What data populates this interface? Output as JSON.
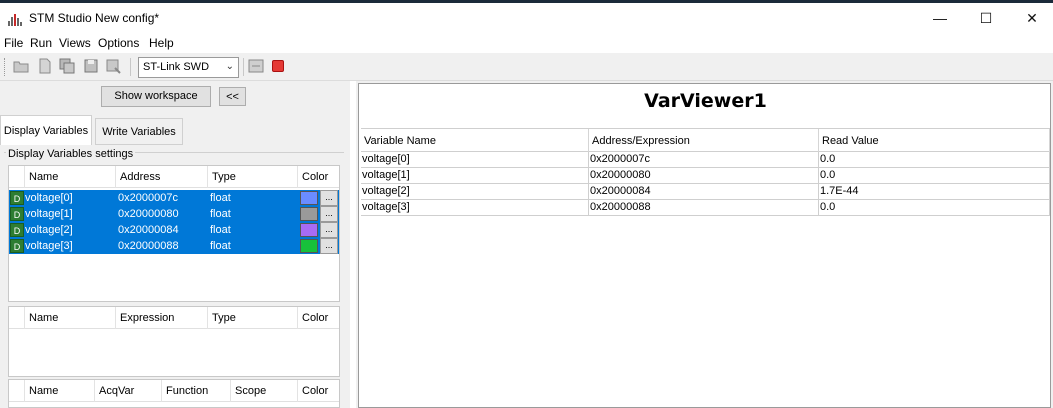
{
  "window": {
    "title": "STM Studio New config*",
    "minimize_glyph": "—",
    "maximize_glyph": "☐",
    "close_glyph": "✕"
  },
  "menu": [
    "File",
    "Run",
    "Views",
    "Options",
    "Help"
  ],
  "toolbar": {
    "probe": "ST-Link SWD",
    "icons": [
      "open-folder-icon",
      "new-file-icon",
      "save-all-icon",
      "save-icon",
      "export-icon",
      "connect-icon",
      "stop-icon"
    ]
  },
  "left": {
    "show_workspace": "Show workspace",
    "collapse": "<<",
    "tabs": [
      "Display Variables",
      "Write Variables"
    ],
    "group_label": "Display Variables settings",
    "var_headers": [
      "Name",
      "Address",
      "Type",
      "Color"
    ],
    "variables": [
      {
        "badge": "D",
        "name": "voltage[0]",
        "address": "0x2000007c",
        "type": "float",
        "color": "#6a8cff",
        "dots": "..."
      },
      {
        "badge": "D",
        "name": "voltage[1]",
        "address": "0x20000080",
        "type": "float",
        "color": "#9a9a9a",
        "dots": "..."
      },
      {
        "badge": "D",
        "name": "voltage[2]",
        "address": "0x20000084",
        "type": "float",
        "color": "#a86bf5",
        "dots": "..."
      },
      {
        "badge": "D",
        "name": "voltage[3]",
        "address": "0x20000088",
        "type": "float",
        "color": "#17c13b",
        "dots": "..."
      }
    ],
    "expr_headers": [
      "Name",
      "Expression",
      "Type",
      "Color"
    ],
    "acq_headers": [
      "Name",
      "AcqVar",
      "Function",
      "Scope",
      "Color"
    ]
  },
  "viewer": {
    "title": "VarViewer1",
    "headers": [
      "Variable Name",
      "Address/Expression",
      "Read Value"
    ],
    "rows": [
      [
        "voltage[0]",
        "0x2000007c",
        "0.0"
      ],
      [
        "voltage[1]",
        "0x20000080",
        "0.0"
      ],
      [
        "voltage[2]",
        "0x20000084",
        "1.7E-44"
      ],
      [
        "voltage[3]",
        "0x20000088",
        "0.0"
      ]
    ]
  },
  "colors": {
    "selection": "#0078d7",
    "badge": "#2e7d32",
    "stop": "#e53935"
  }
}
